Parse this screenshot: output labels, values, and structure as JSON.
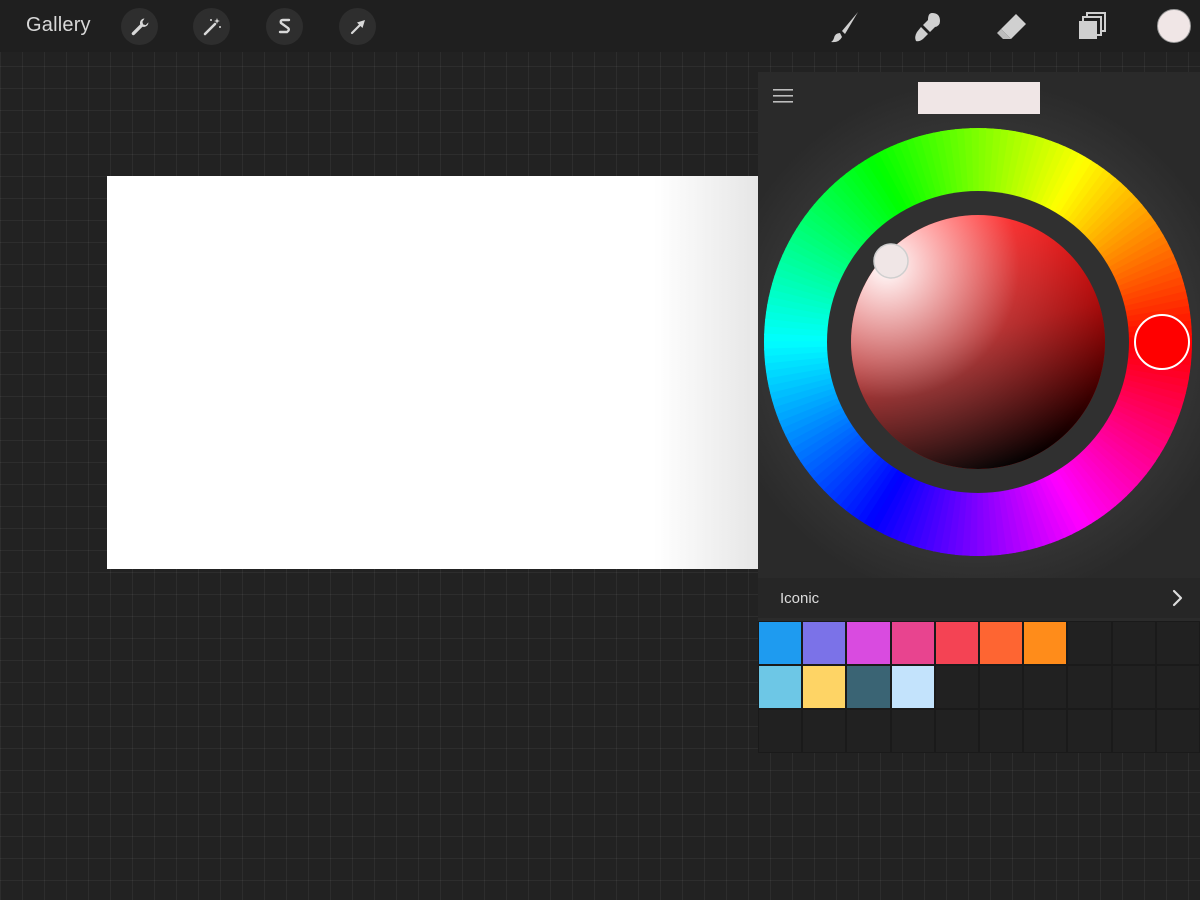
{
  "topbar": {
    "gallery_label": "Gallery",
    "left_tools": [
      "wrench-icon",
      "magic-wand-icon",
      "selection-icon",
      "transform-arrow-icon"
    ],
    "right_tools": [
      "brush-icon",
      "smudge-icon",
      "eraser-icon",
      "layers-icon"
    ],
    "current_color": "#f0e6e6"
  },
  "color_panel": {
    "menu_icon": "hamburger-icon",
    "selected_color": "#f0e6e6",
    "hue": "#ff0000",
    "palette": {
      "name": "Iconic",
      "swatches": [
        "#1e9bf0",
        "#7b72e8",
        "#d94be0",
        "#e8448f",
        "#f44354",
        "#fe6532",
        "#ff8c1a",
        "",
        "",
        "",
        "#6dc7e6",
        "#fed465",
        "#3a6474",
        "#c3e3fc",
        "",
        "",
        "",
        "",
        "",
        "",
        "",
        "",
        "",
        "",
        "",
        "",
        "",
        "",
        "",
        ""
      ]
    }
  }
}
